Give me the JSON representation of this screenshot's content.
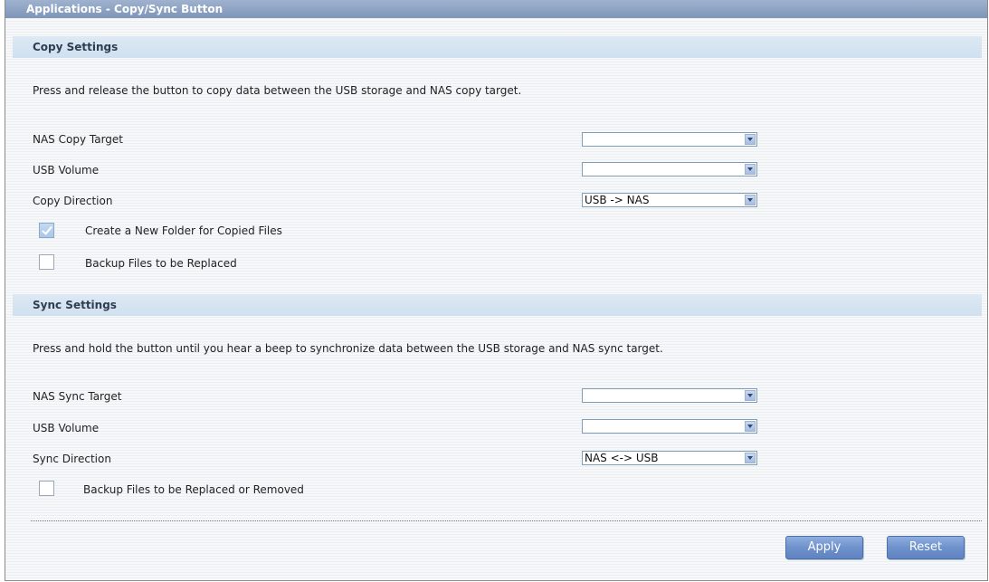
{
  "window": {
    "title": "Applications - Copy/Sync Button"
  },
  "copy": {
    "heading": "Copy Settings",
    "description": "Press and release the button to copy data between the USB storage and NAS copy target.",
    "nas_target_label": "NAS Copy Target",
    "nas_target_value": "",
    "usb_volume_label": "USB Volume",
    "usb_volume_value": "",
    "direction_label": "Copy Direction",
    "direction_value": "USB -> NAS",
    "new_folder_label": "Create a New Folder for Copied Files",
    "new_folder_checked": true,
    "backup_label": "Backup Files to be Replaced",
    "backup_checked": false
  },
  "sync": {
    "heading": "Sync Settings",
    "description": "Press and hold the button until you hear a beep to synchronize data between the USB storage and NAS sync target.",
    "nas_target_label": "NAS Sync Target",
    "nas_target_value": "",
    "usb_volume_label": "USB Volume",
    "usb_volume_value": "",
    "direction_label": "Sync Direction",
    "direction_value": "NAS <-> USB",
    "backup_label": "Backup Files to be Replaced or Removed",
    "backup_checked": false
  },
  "buttons": {
    "apply": "Apply",
    "reset": "Reset"
  },
  "colors": {
    "title_bar": "#8fa4c6",
    "section_header": "#d6e5f2",
    "button": "#6f91cb"
  }
}
